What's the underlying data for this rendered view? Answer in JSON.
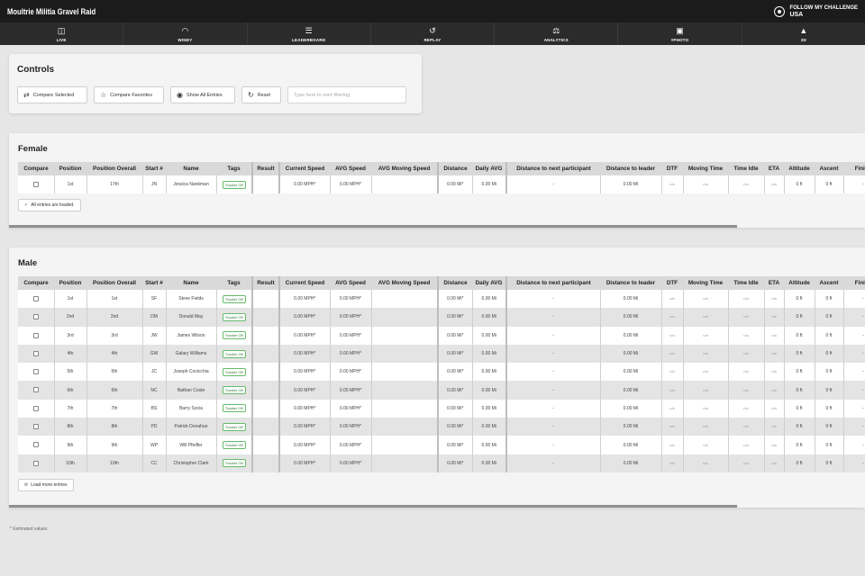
{
  "app": {
    "title": "Moultrie Militia Gravel Raid",
    "brand_line1": "FOLLOW MY CHALLENGE",
    "brand_line2": "USA"
  },
  "nav": [
    {
      "label": "LIVE",
      "icon": "map-icon",
      "glyph": "◫"
    },
    {
      "label": "WINDY",
      "icon": "gauge-icon",
      "glyph": "◠"
    },
    {
      "label": "LEADERBOARD",
      "icon": "leaderboard-icon",
      "glyph": "☰"
    },
    {
      "label": "REPLAY",
      "icon": "replay-icon",
      "glyph": "↺"
    },
    {
      "label": "ANALYTICS",
      "icon": "analytics-icon",
      "glyph": "⚖"
    },
    {
      "label": "#PHOTO",
      "icon": "camera-icon",
      "glyph": "▣"
    },
    {
      "label": "3D",
      "icon": "mountain-icon",
      "glyph": "▲"
    }
  ],
  "controls": {
    "title": "Controls",
    "compare_selected": "Compare Selected",
    "compare_favorites": "Compare Favorites",
    "show_all": "Show All Entries",
    "reset": "Reset",
    "filter_placeholder": "Type here to start filtering"
  },
  "columns": [
    "Compare",
    "Position",
    "Position Overall",
    "Start #",
    "Name",
    "Tags",
    "Result",
    "Current Speed",
    "AVG Speed",
    "AVG Moving Speed",
    "Distance",
    "Daily AVG",
    "Distance to next participant",
    "Distance to leader",
    "DTF",
    "Moving Time",
    "Time Idle",
    "ETA",
    "Altitude",
    "Ascent",
    "Finish"
  ],
  "female": {
    "title": "Female",
    "rows": [
      {
        "pos": "1st",
        "overall": "17th",
        "start": "JN",
        "name": "Jessica Nankman",
        "tag": "Tracker Off",
        "cur": "0.00 MPH*",
        "avg": "0.00 MPH*",
        "dist": "0.00 Mi*",
        "daily": "0.00 Mi",
        "next": "-",
        "leader": "0.00 Mi",
        "dtf": "n/a",
        "moving": "n/a",
        "idle": "n/a",
        "eta": "n/a",
        "alt": "0 ft",
        "ascent": "0 ft",
        "finish": "-"
      }
    ],
    "loaded_label": "All entries are loaded."
  },
  "male": {
    "title": "Male",
    "rows": [
      {
        "pos": "1st",
        "overall": "1st",
        "start": "SF",
        "name": "Steve Fields",
        "tag": "Tracker Off",
        "cur": "0.00 MPH*",
        "avg": "0.00 MPH*",
        "dist": "0.00 Mi*",
        "daily": "0.00 Mi",
        "next": "-",
        "leader": "0.00 Mi",
        "dtf": "n/a",
        "moving": "n/a",
        "idle": "n/a",
        "eta": "n/a",
        "alt": "0 ft",
        "ascent": "0 ft",
        "finish": "-"
      },
      {
        "pos": "2nd",
        "overall": "2nd",
        "start": "DM",
        "name": "Donald May",
        "tag": "Tracker Off",
        "cur": "0.00 MPH*",
        "avg": "0.00 MPH*",
        "dist": "0.00 Mi*",
        "daily": "0.00 Mi",
        "next": "-",
        "leader": "0.00 Mi",
        "dtf": "n/a",
        "moving": "n/a",
        "idle": "n/a",
        "eta": "n/a",
        "alt": "0 ft",
        "ascent": "0 ft",
        "finish": "-"
      },
      {
        "pos": "3rd",
        "overall": "3rd",
        "start": "JW",
        "name": "James Wilson",
        "tag": "Tracker Off",
        "cur": "0.00 MPH*",
        "avg": "0.00 MPH*",
        "dist": "0.00 Mi*",
        "daily": "0.00 Mi",
        "next": "-",
        "leader": "0.00 Mi",
        "dtf": "n/a",
        "moving": "n/a",
        "idle": "n/a",
        "eta": "n/a",
        "alt": "0 ft",
        "ascent": "0 ft",
        "finish": "-"
      },
      {
        "pos": "4th",
        "overall": "4th",
        "start": "GW",
        "name": "Galary Williams",
        "tag": "Tracker Off",
        "cur": "0.00 MPH*",
        "avg": "0.00 MPH*",
        "dist": "0.00 Mi*",
        "daily": "0.00 Mi",
        "next": "-",
        "leader": "0.00 Mi",
        "dtf": "n/a",
        "moving": "n/a",
        "idle": "n/a",
        "eta": "n/a",
        "alt": "0 ft",
        "ascent": "0 ft",
        "finish": "-"
      },
      {
        "pos": "5th",
        "overall": "5th",
        "start": "JC",
        "name": "Joseph Covicchia",
        "tag": "Tracker Off",
        "cur": "0.00 MPH*",
        "avg": "0.00 MPH*",
        "dist": "0.00 Mi*",
        "daily": "0.00 Mi",
        "next": "-",
        "leader": "0.00 Mi",
        "dtf": "n/a",
        "moving": "n/a",
        "idle": "n/a",
        "eta": "n/a",
        "alt": "0 ft",
        "ascent": "0 ft",
        "finish": "-"
      },
      {
        "pos": "6th",
        "overall": "6th",
        "start": "NC",
        "name": "Nathan Coste",
        "tag": "Tracker Off",
        "cur": "0.00 MPH*",
        "avg": "0.00 MPH*",
        "dist": "0.00 Mi*",
        "daily": "0.00 Mi",
        "next": "-",
        "leader": "0.00 Mi",
        "dtf": "n/a",
        "moving": "n/a",
        "idle": "n/a",
        "eta": "n/a",
        "alt": "0 ft",
        "ascent": "0 ft",
        "finish": "-"
      },
      {
        "pos": "7th",
        "overall": "7th",
        "start": "BS",
        "name": "Barry Socia",
        "tag": "Tracker Off",
        "cur": "0.00 MPH*",
        "avg": "0.00 MPH*",
        "dist": "0.00 Mi*",
        "daily": "0.00 Mi",
        "next": "-",
        "leader": "0.00 Mi",
        "dtf": "n/a",
        "moving": "n/a",
        "idle": "n/a",
        "eta": "n/a",
        "alt": "0 ft",
        "ascent": "0 ft",
        "finish": "-"
      },
      {
        "pos": "8th",
        "overall": "8th",
        "start": "PD",
        "name": "Patrick Donahue",
        "tag": "Tracker Off",
        "cur": "0.00 MPH*",
        "avg": "0.00 MPH*",
        "dist": "0.00 Mi*",
        "daily": "0.00 Mi",
        "next": "-",
        "leader": "0.00 Mi",
        "dtf": "n/a",
        "moving": "n/a",
        "idle": "n/a",
        "eta": "n/a",
        "alt": "0 ft",
        "ascent": "0 ft",
        "finish": "-"
      },
      {
        "pos": "9th",
        "overall": "9th",
        "start": "WP",
        "name": "Will Pfeiffer",
        "tag": "Tracker Off",
        "cur": "0.00 MPH*",
        "avg": "0.00 MPH*",
        "dist": "0.00 Mi*",
        "daily": "0.00 Mi",
        "next": "-",
        "leader": "0.00 Mi",
        "dtf": "n/a",
        "moving": "n/a",
        "idle": "n/a",
        "eta": "n/a",
        "alt": "0 ft",
        "ascent": "0 ft",
        "finish": "-"
      },
      {
        "pos": "10th",
        "overall": "10th",
        "start": "CC",
        "name": "Christopher Clark",
        "tag": "Tracker Off",
        "cur": "0.00 MPH*",
        "avg": "0.00 MPH*",
        "dist": "0.00 Mi*",
        "daily": "0.00 Mi",
        "next": "-",
        "leader": "0.00 Mi",
        "dtf": "n/a",
        "moving": "n/a",
        "idle": "n/a",
        "eta": "n/a",
        "alt": "0 ft",
        "ascent": "0 ft",
        "finish": "-"
      }
    ],
    "load_more_label": "Load more entries"
  },
  "footnote": "* Estimated values",
  "colors": {
    "topbar": "#1b1b1b",
    "navbar": "#2b2b2b",
    "tag_green": "#2e7d32",
    "page_bg": "#e6e6e6"
  }
}
